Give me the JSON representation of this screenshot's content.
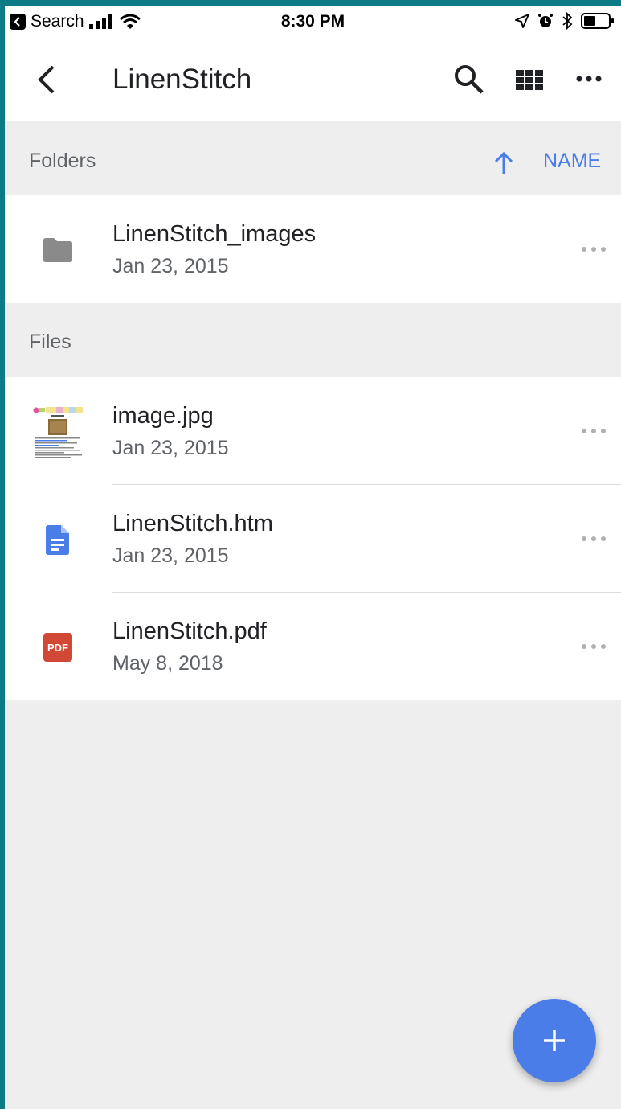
{
  "status_bar": {
    "back_app": "Search",
    "time": "8:30 PM"
  },
  "app_bar": {
    "title": "LinenStitch",
    "icons": [
      "back-arrow-icon",
      "search-icon",
      "grid-view-icon",
      "more-horizontal-icon"
    ]
  },
  "folders_section": {
    "label": "Folders",
    "sort_label": "NAME",
    "sort_direction": "ascending",
    "items": [
      {
        "name": "LinenStitch_images",
        "date": "Jan 23, 2015",
        "icon": "folder-icon"
      }
    ]
  },
  "files_section": {
    "label": "Files",
    "items": [
      {
        "name": "image.jpg",
        "date": "Jan 23, 2015",
        "icon": "image-thumbnail"
      },
      {
        "name": "LinenStitch.htm",
        "date": "Jan 23, 2015",
        "icon": "doc-icon"
      },
      {
        "name": "LinenStitch.pdf",
        "date": "May 8, 2018",
        "icon": "pdf-icon",
        "badge": "PDF"
      }
    ]
  },
  "colors": {
    "accent": "#4a7de8",
    "pdf_red": "#d14836",
    "folder_gray": "#8a8a8a",
    "background": "#eeeeee"
  },
  "fab": {
    "icon": "plus-icon"
  }
}
